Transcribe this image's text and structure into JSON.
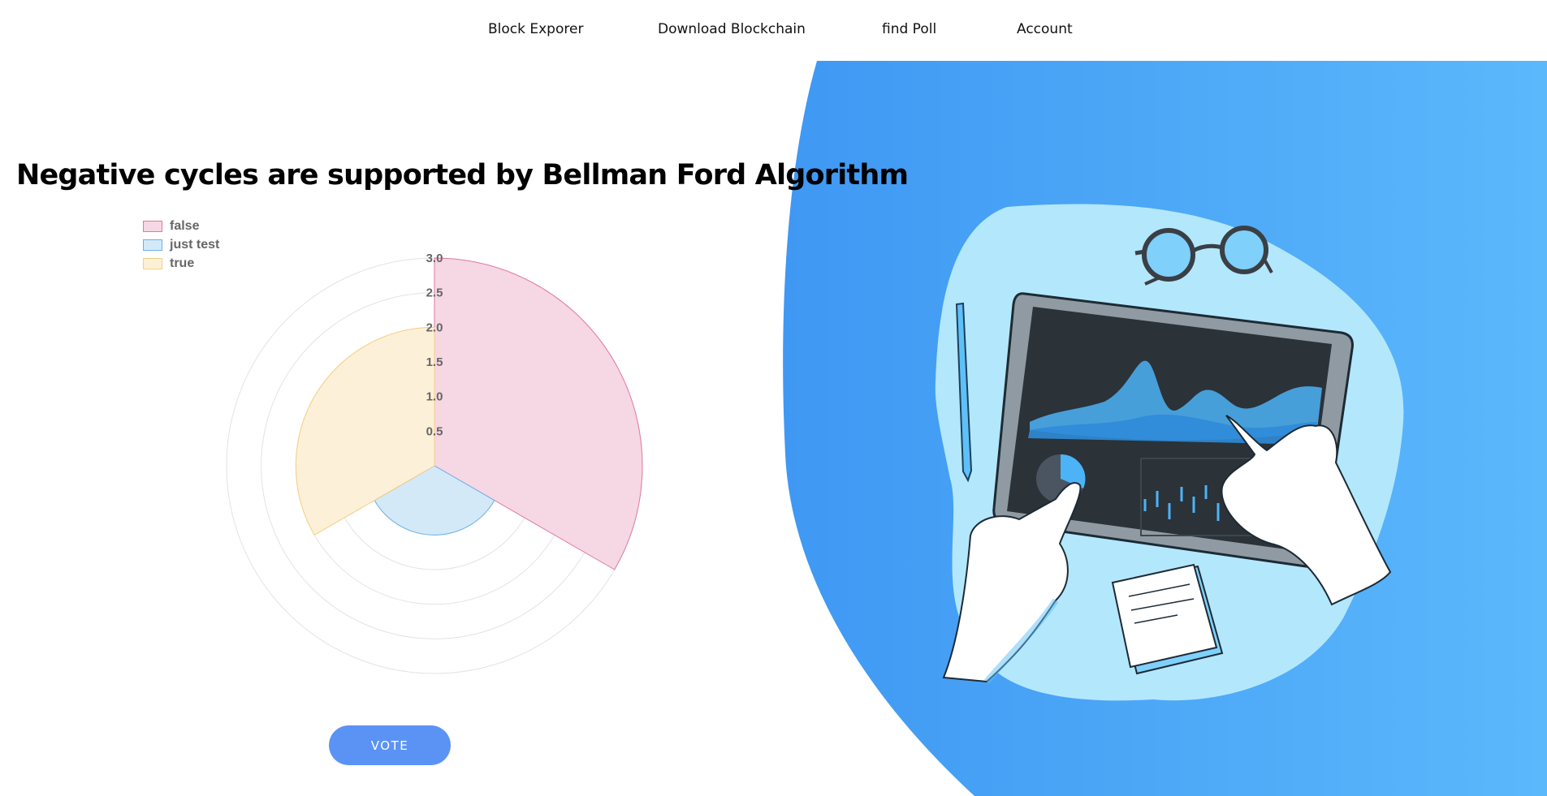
{
  "nav": {
    "items": [
      {
        "label": "Block Exporer"
      },
      {
        "label": "Download Blockchain"
      },
      {
        "label": "find Poll"
      },
      {
        "label": "Account"
      }
    ]
  },
  "poll": {
    "title": "Negative cycles are supported by Bellman Ford Algorithm",
    "vote_label": "VOTE"
  },
  "chart_data": {
    "type": "polarArea",
    "title": "Negative cycles are supported by Bellman Ford Algorithm",
    "categories": [
      "false",
      "just test",
      "true"
    ],
    "values": [
      3,
      1,
      2
    ],
    "colors": {
      "false": {
        "fill": "#f6d7e4",
        "stroke": "#e0799f"
      },
      "just test": {
        "fill": "#d3e9f8",
        "stroke": "#6bb0e6"
      },
      "true": {
        "fill": "#fdf0d8",
        "stroke": "#f4cf82"
      }
    },
    "r_axis": {
      "min": 0,
      "max": 3,
      "ticks": [
        "0.5",
        "1.0",
        "1.5",
        "2.0",
        "2.5",
        "3.0"
      ]
    },
    "legend_position": "top-left",
    "grid": true
  },
  "illustration": {
    "background_color": "#4aa8f7",
    "blob_color": "#b3e7fc",
    "icon": "tablet-analytics-illustration"
  }
}
